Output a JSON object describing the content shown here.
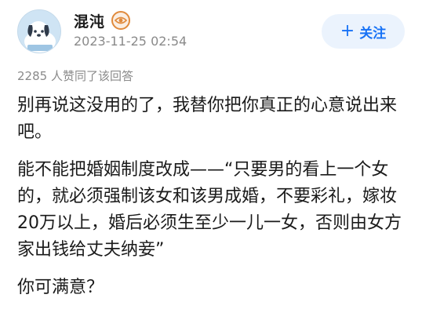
{
  "author": {
    "name": "混沌",
    "avatar_icon": "cartoon-dog-avatar",
    "badge_icon": "eye-badge-icon",
    "timestamp": "2023-11-25 02:54"
  },
  "follow_button": {
    "icon": "+",
    "label": "关注"
  },
  "likes_text": "2285 人赞同了该回答",
  "answer": {
    "paragraphs": [
      "别再说这没用的了，我替你把你真正的心意说出来吧。",
      "能不能把婚姻制度改成——“只要男的看上一个女的，就必须强制该女和该男成婚，不要彩礼，嫁妆20万以上，婚后必须生至少一儿一女，否则由女方家出钱给丈夫纳妾”",
      "你可满意？"
    ]
  },
  "colors": {
    "accent": "#1772f6",
    "button_bg": "#ebf3fd",
    "secondary_text": "#8a8a8a",
    "badge": "#e08a3c"
  }
}
